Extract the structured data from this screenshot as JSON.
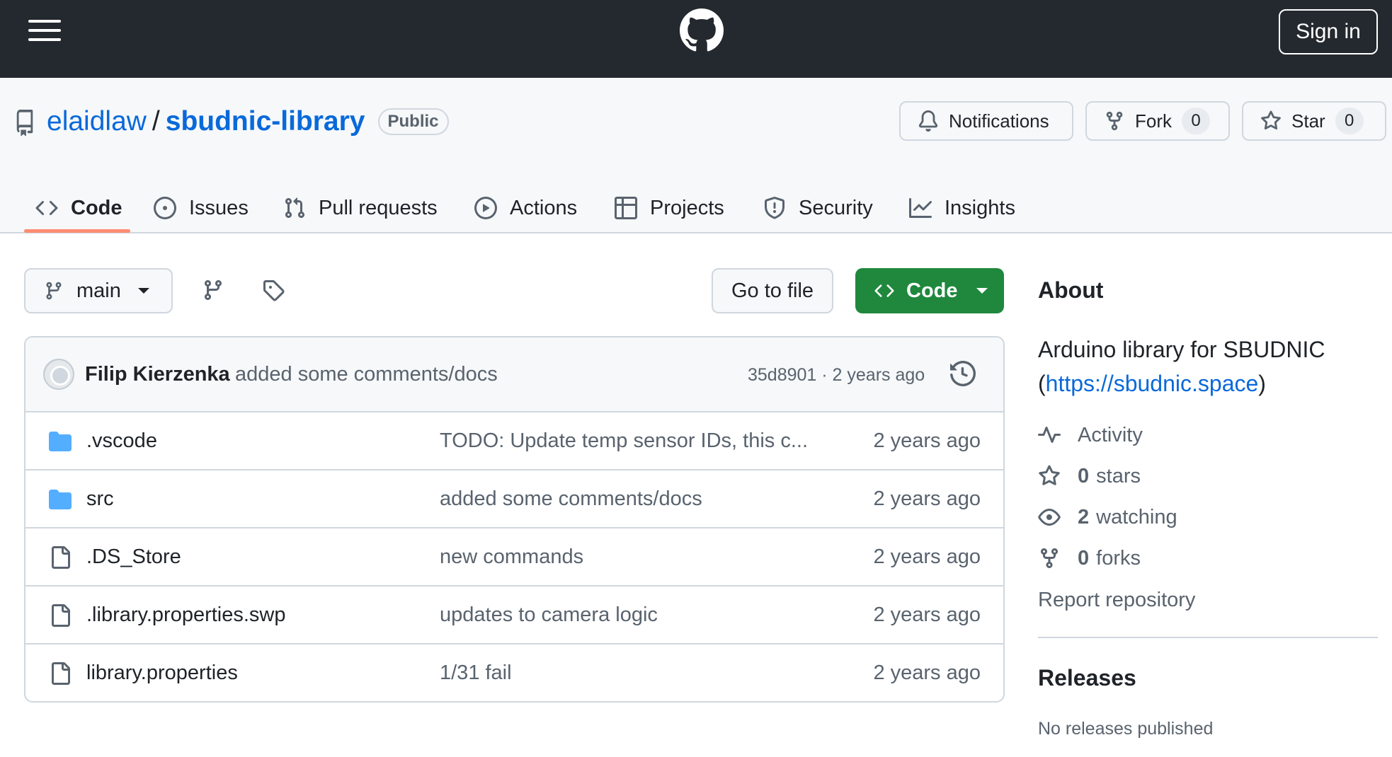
{
  "header": {
    "menu_icon": "hamburger-icon",
    "logo_icon": "github-logo-icon",
    "signin_label": "Sign in"
  },
  "repo": {
    "icon": "repo-icon",
    "owner": "elaidlaw",
    "separator": "/",
    "name": "sbudnic-library",
    "visibility": "Public",
    "notifications_label": "Notifications",
    "fork_label": "Fork",
    "fork_count": "0",
    "star_label": "Star",
    "star_count": "0"
  },
  "tabs": [
    {
      "label": "Code",
      "icon": "code-icon",
      "active": true
    },
    {
      "label": "Issues",
      "icon": "issue-icon"
    },
    {
      "label": "Pull requests",
      "icon": "pull-request-icon"
    },
    {
      "label": "Actions",
      "icon": "play-icon"
    },
    {
      "label": "Projects",
      "icon": "table-icon"
    },
    {
      "label": "Security",
      "icon": "shield-icon"
    },
    {
      "label": "Insights",
      "icon": "graph-icon"
    }
  ],
  "toolbar": {
    "branch": "main",
    "goto_file": "Go to file",
    "code_button": "Code"
  },
  "commit": {
    "author": "Filip Kierzenka",
    "message": "added some comments/docs",
    "meta": "35d8901 · 2 years ago"
  },
  "files": [
    {
      "type": "folder",
      "name": ".vscode",
      "message": "TODO: Update temp sensor IDs, this c...",
      "age": "2 years ago"
    },
    {
      "type": "folder",
      "name": "src",
      "message": "added some comments/docs",
      "age": "2 years ago"
    },
    {
      "type": "file",
      "name": ".DS_Store",
      "message": "new commands",
      "age": "2 years ago"
    },
    {
      "type": "file",
      "name": ".library.properties.swp",
      "message": "updates to camera logic",
      "age": "2 years ago"
    },
    {
      "type": "file",
      "name": "library.properties",
      "message": "1/31 fail",
      "age": "2 years ago"
    }
  ],
  "about": {
    "heading": "About",
    "description": "Arduino library for SBUDNIC",
    "link_open": "(",
    "link": "https://sbudnic.space",
    "link_close": ")",
    "activity": "Activity",
    "stars_count": "0",
    "stars_label": "stars",
    "watching_count": "2",
    "watching_label": "watching",
    "forks_count": "0",
    "forks_label": "forks",
    "report": "Report repository"
  },
  "releases": {
    "heading": "Releases",
    "empty": "No releases published"
  },
  "colors": {
    "header_bg": "#24292f",
    "link": "#0969da",
    "primary_button": "#1f883d",
    "active_tab_underline": "#fd8c73",
    "folder": "#54aeff"
  }
}
